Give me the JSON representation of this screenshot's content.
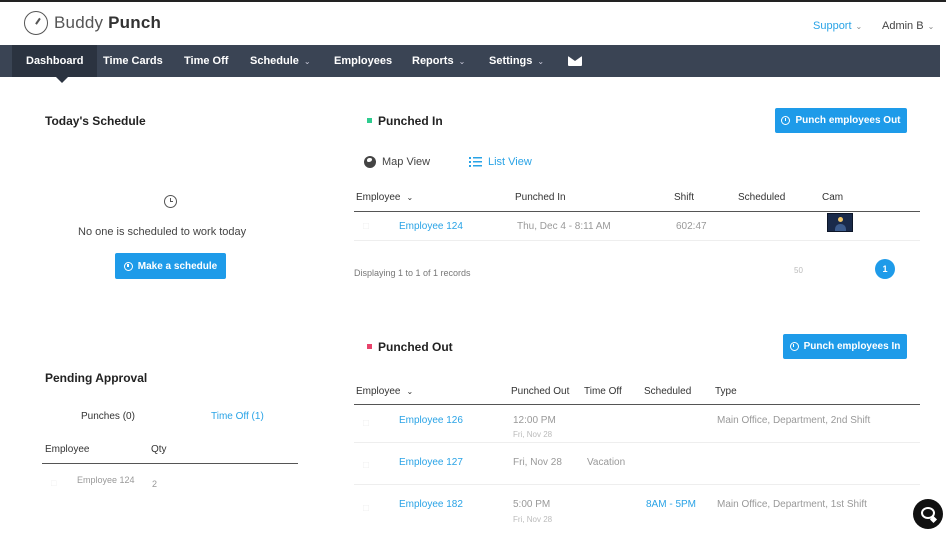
{
  "header": {
    "brand_light": "Buddy",
    "brand_bold": "Punch",
    "support_label": "Support",
    "admin_label": "Admin B"
  },
  "nav": {
    "dashboard": "Dashboard",
    "time_cards": "Time Cards",
    "time_off": "Time Off",
    "schedule": "Schedule",
    "employees": "Employees",
    "reports": "Reports",
    "settings": "Settings",
    "mail_icon": "envelope-icon"
  },
  "todays_schedule": {
    "title": "Today's Schedule",
    "empty_message": "No one is scheduled to work today",
    "make_schedule_button": "Make a schedule"
  },
  "pending_approval": {
    "title": "Pending Approval",
    "tab_punches": "Punches (0)",
    "tab_time_off": "Time Off (1)",
    "col_employee": "Employee",
    "col_qty": "Qty",
    "rows": [
      {
        "employee": "Employee 124",
        "qty": "2"
      }
    ]
  },
  "punched_in": {
    "title": "Punched In",
    "status_color": "#2ecc8f",
    "punch_out_button": "Punch employees Out",
    "map_view": "Map View",
    "list_view": "List View",
    "columns": {
      "employee": "Employee",
      "punched_in": "Punched In",
      "shift": "Shift",
      "scheduled": "Scheduled",
      "cam": "Cam"
    },
    "rows": [
      {
        "employee": "Employee 124",
        "punched_in": "Thu, Dec 4 - 8:11 AM",
        "shift": "602:47",
        "scheduled": ""
      }
    ],
    "records_text": "Displaying 1 to 1 of 1 records",
    "page_size": "50",
    "current_page": "1"
  },
  "punched_out": {
    "title": "Punched Out",
    "status_color": "#e8436b",
    "punch_in_button": "Punch employees In",
    "columns": {
      "employee": "Employee",
      "punched_out": "Punched Out",
      "time_off": "Time Off",
      "scheduled": "Scheduled",
      "type": "Type"
    },
    "rows": [
      {
        "employee": "Employee 126",
        "punched_out": "12:00 PM",
        "punched_out_date": "Fri, Nov 28",
        "time_off": "",
        "scheduled": "",
        "type": "Main Office, Department, 2nd Shift"
      },
      {
        "employee": "Employee 127",
        "punched_out": "Fri, Nov 28",
        "punched_out_date": "",
        "time_off": "Vacation",
        "scheduled": "",
        "type": ""
      },
      {
        "employee": "Employee 182",
        "punched_out": "5:00 PM",
        "punched_out_date": "Fri, Nov 28",
        "time_off": "",
        "scheduled": "8AM - 5PM",
        "type": "Main Office, Department, 1st Shift"
      }
    ]
  },
  "colors": {
    "nav_bg": "#3a4454",
    "accent": "#1e9be9"
  }
}
